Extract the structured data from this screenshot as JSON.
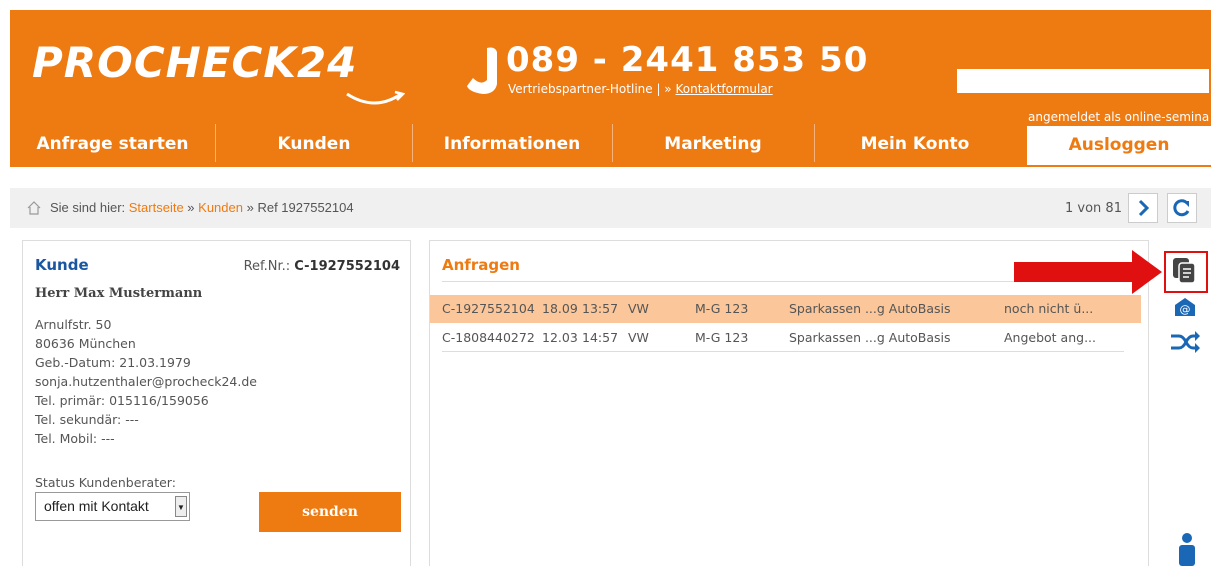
{
  "header": {
    "logo": "PROCHECK24",
    "hotline_number": "089 - 2441 853 50",
    "hotline_label": "Vertriebspartner-Hotline | » ",
    "contact_link": "Kontaktformular",
    "search_placeholder": "",
    "logged_in_text": "angemeldet als online-semina"
  },
  "nav": {
    "items": [
      "Anfrage starten",
      "Kunden",
      "Informationen",
      "Marketing",
      "Mein Konto"
    ],
    "logout": "Ausloggen"
  },
  "breadcrumb": {
    "prefix": "Sie sind hier: ",
    "home": "Startseite",
    "sep1": " » ",
    "kunden": "Kunden",
    "sep2": " » ",
    "current": "Ref 1927552104",
    "pager": "1 von 81"
  },
  "customer": {
    "title": "Kunde",
    "ref_label": "Ref.Nr.: ",
    "ref_value": "C-1927552104",
    "name": "Herr Max Mustermann",
    "street": "Arnulfstr. 50",
    "city": "80636 München",
    "birth": "Geb.-Datum: 21.03.1979",
    "email": "sonja.hutzenthaler@procheck24.de",
    "tel_primary": "Tel. primär: 015116/159056",
    "tel_secondary": "Tel. sekundär: ---",
    "tel_mobile": "Tel. Mobil: ---",
    "status_label": "Status Kundenberater:",
    "status_value": "offen mit Kontakt",
    "send_label": "senden"
  },
  "requests": {
    "title": "Anfragen",
    "rows": [
      {
        "ref": "C-1927552104",
        "date": "18.09",
        "time": "13:57",
        "make": "VW",
        "plate": "M-G 123",
        "product": "Sparkassen ...g AutoBasis",
        "status": "noch nicht ü..."
      },
      {
        "ref": "C-1808440272",
        "date": "12.03",
        "time": "14:57",
        "make": "VW",
        "plate": "M-G 123",
        "product": "Sparkassen ...g AutoBasis",
        "status": "Angebot ang..."
      }
    ]
  },
  "colors": {
    "brand": "#ee7a12",
    "link_blue": "#1a57a0",
    "highlight": "#fbc79a",
    "marker_red": "#e01010"
  },
  "icons": [
    "phone-icon",
    "search-icon",
    "home-icon",
    "chevron-right-icon",
    "refresh-icon",
    "copy-document-icon",
    "email-icon",
    "shuffle-icon",
    "person-icon",
    "red-arrow-icon"
  ]
}
